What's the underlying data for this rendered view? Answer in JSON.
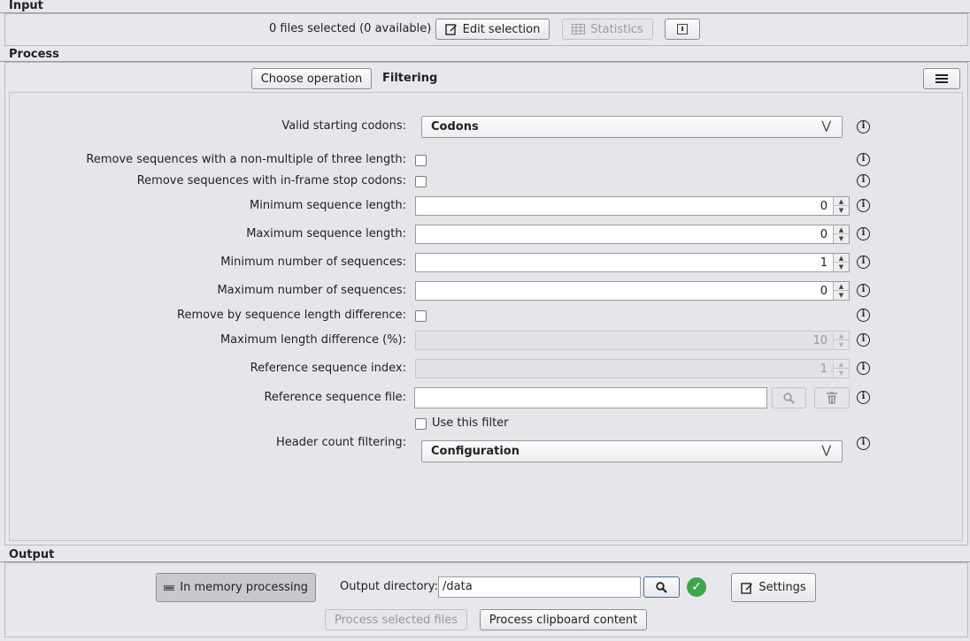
{
  "input": {
    "title": "Input",
    "files_selected": "0 files selected (0 available)",
    "edit_selection": "Edit selection",
    "statistics": "Statistics"
  },
  "process": {
    "title": "Process",
    "choose_operation": "Choose operation",
    "operation_name": "Filtering"
  },
  "form": {
    "valid_codons_label": "Valid starting codons:",
    "valid_codons_value": "Codons",
    "non_multiple_label": "Remove sequences with a non-multiple of three length:",
    "inframe_stop_label": "Remove sequences with in-frame stop codons:",
    "min_seq_length_label": "Minimum sequence length:",
    "min_seq_length_value": "0",
    "max_seq_length_label": "Maximum sequence length:",
    "max_seq_length_value": "0",
    "min_num_seq_label": "Minimum number of sequences:",
    "min_num_seq_value": "1",
    "max_num_seq_label": "Maximum number of sequences:",
    "max_num_seq_value": "0",
    "remove_by_diff_label": "Remove by sequence length difference:",
    "max_length_diff_label": "Maximum length difference (%):",
    "max_length_diff_value": "10",
    "ref_seq_index_label": "Reference sequence index:",
    "ref_seq_index_value": "1",
    "ref_seq_file_label": "Reference sequence file:",
    "ref_seq_file_value": "",
    "use_filter_label": "Use this filter",
    "header_count_label": "Header count filtering:",
    "header_count_value": "Configuration"
  },
  "output": {
    "title": "Output",
    "in_memory": "In memory processing",
    "output_dir_label": "Output directory:",
    "output_dir_value": "/data",
    "settings": "Settings",
    "process_selected": "Process selected files",
    "process_clipboard": "Process clipboard content"
  },
  "icons": {
    "info": "info-circle-icon",
    "search": "magnifier-icon",
    "trash": "trash-icon",
    "edit": "edit-icon",
    "table": "table-icon",
    "menu": "hamburger-menu-icon",
    "ok": "check-circle-icon",
    "keyboard": "memory-chip-icon"
  },
  "colors": {
    "ok_green": "#3aa84a",
    "background": "#e8e8ec"
  }
}
